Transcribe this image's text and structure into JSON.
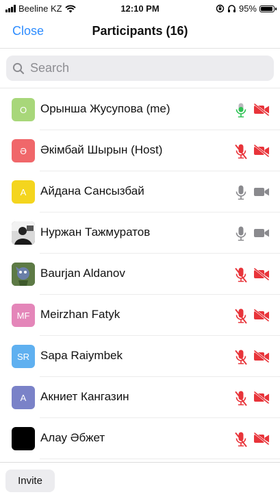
{
  "status_bar": {
    "carrier": "Beeline KZ",
    "time": "12:10 PM",
    "battery": "95%"
  },
  "header": {
    "close_label": "Close",
    "title": "Participants (16)"
  },
  "search": {
    "placeholder": "Search"
  },
  "participants": [
    {
      "initial": "О",
      "name": "Орынша Жусупова (me)",
      "avatar_color": "#a8d77a",
      "mic": "on",
      "video": "off"
    },
    {
      "initial": "Ә",
      "name": "Әкімбай Шырын (Host)",
      "avatar_color": "#f0676a",
      "mic": "off",
      "video": "off"
    },
    {
      "initial": "А",
      "name": "Айдана Сансызбай",
      "avatar_color": "#f4d51e",
      "mic": "idle",
      "video": "idle"
    },
    {
      "initial": "",
      "name": "Нуржан Тажмуратов",
      "avatar_color": "#3a3a3a",
      "mic": "idle",
      "video": "idle"
    },
    {
      "initial": "",
      "name": "Baurjan Aldanov",
      "avatar_color": "#4c6b3e",
      "mic": "off",
      "video": "off"
    },
    {
      "initial": "MF",
      "name": "Meirzhan Fatyk",
      "avatar_color": "#e486b9",
      "mic": "off",
      "video": "off"
    },
    {
      "initial": "SR",
      "name": "Sapa Raiymbek",
      "avatar_color": "#5fb0f0",
      "mic": "off",
      "video": "off"
    },
    {
      "initial": "А",
      "name": "Акниет Кангазин",
      "avatar_color": "#7a82c8",
      "mic": "off",
      "video": "off"
    },
    {
      "initial": "",
      "name": "Алау Әбжет",
      "avatar_color": "#000000",
      "mic": "off",
      "video": "off"
    }
  ],
  "footer": {
    "invite_label": "Invite"
  },
  "colors": {
    "accent": "#2d8cff",
    "muted_red": "#e8343a",
    "mic_on_green": "#2ec254",
    "idle_gray": "#8a8a8e"
  }
}
